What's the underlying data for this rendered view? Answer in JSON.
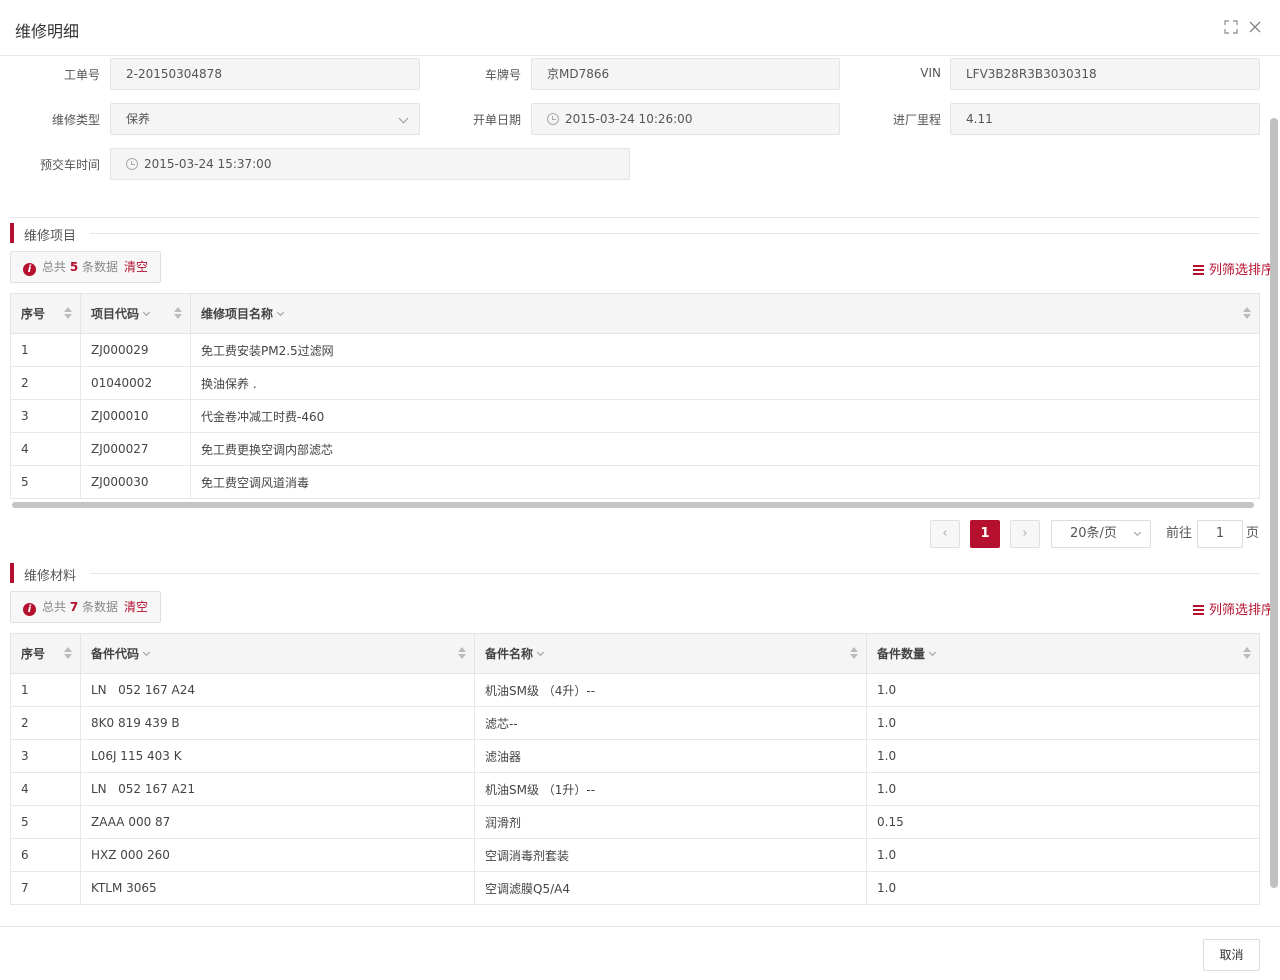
{
  "dialog": {
    "title": "维修明细",
    "cancel_label": "取消"
  },
  "form": {
    "order_no_label": "工单号",
    "order_no_value": "2-20150304878",
    "plate_label": "车牌号",
    "plate_value": "京MD7866",
    "vin_label": "VIN",
    "vin_value": "LFV3B28R3B3030318",
    "repair_type_label": "维修类型",
    "repair_type_value": "保养",
    "open_date_label": "开单日期",
    "open_date_value": "2015-03-24 10:26:00",
    "mileage_label": "进厂里程",
    "mileage_value": "4.11",
    "delivery_label": "预交车时间",
    "delivery_value": "2015-03-24 15:37:00"
  },
  "items_section": {
    "title": "维修项目",
    "summary_prefix": "总共",
    "count": "5",
    "summary_suffix": "条数据",
    "clear_label": "清空",
    "col_filter_label": "列筛选排序",
    "headers": [
      "序号",
      "项目代码",
      "维修项目名称"
    ],
    "rows": [
      [
        "1",
        "ZJ000029",
        "免工费安装PM2.5过滤网"
      ],
      [
        "2",
        "01040002",
        "换油保养 ."
      ],
      [
        "3",
        "ZJ000010",
        "代金卷冲减工时费-460"
      ],
      [
        "4",
        "ZJ000027",
        "免工费更换空调内部滤芯"
      ],
      [
        "5",
        "ZJ000030",
        "免工费空调风道消毒"
      ]
    ]
  },
  "pager": {
    "prev": "‹",
    "page": "1",
    "next": "›",
    "page_size": "20条/页",
    "goto_label": "前往",
    "goto_value": "1",
    "page_unit": "页"
  },
  "materials_section": {
    "title": "维修材料",
    "summary_prefix": "总共",
    "count": "7",
    "summary_suffix": "条数据",
    "clear_label": "清空",
    "col_filter_label": "列筛选排序",
    "headers": [
      "序号",
      "备件代码",
      "备件名称",
      "备件数量"
    ],
    "rows": [
      [
        "1",
        "LN   052 167 A24",
        "机油SM级 （4升）--",
        "1.0"
      ],
      [
        "2",
        "8K0 819 439 B",
        "滤芯--",
        "1.0"
      ],
      [
        "3",
        "L06J 115 403 K",
        "滤油器",
        "1.0"
      ],
      [
        "4",
        "LN   052 167 A21",
        "机油SM级 （1升）--",
        "1.0"
      ],
      [
        "5",
        "ZAAA 000 87",
        "润滑剂",
        "0.15"
      ],
      [
        "6",
        "HXZ 000 260",
        "空调消毒剂套装",
        "1.0"
      ],
      [
        "7",
        "KTLM 3065",
        "空调滤膜Q5/A4",
        "1.0"
      ]
    ]
  }
}
